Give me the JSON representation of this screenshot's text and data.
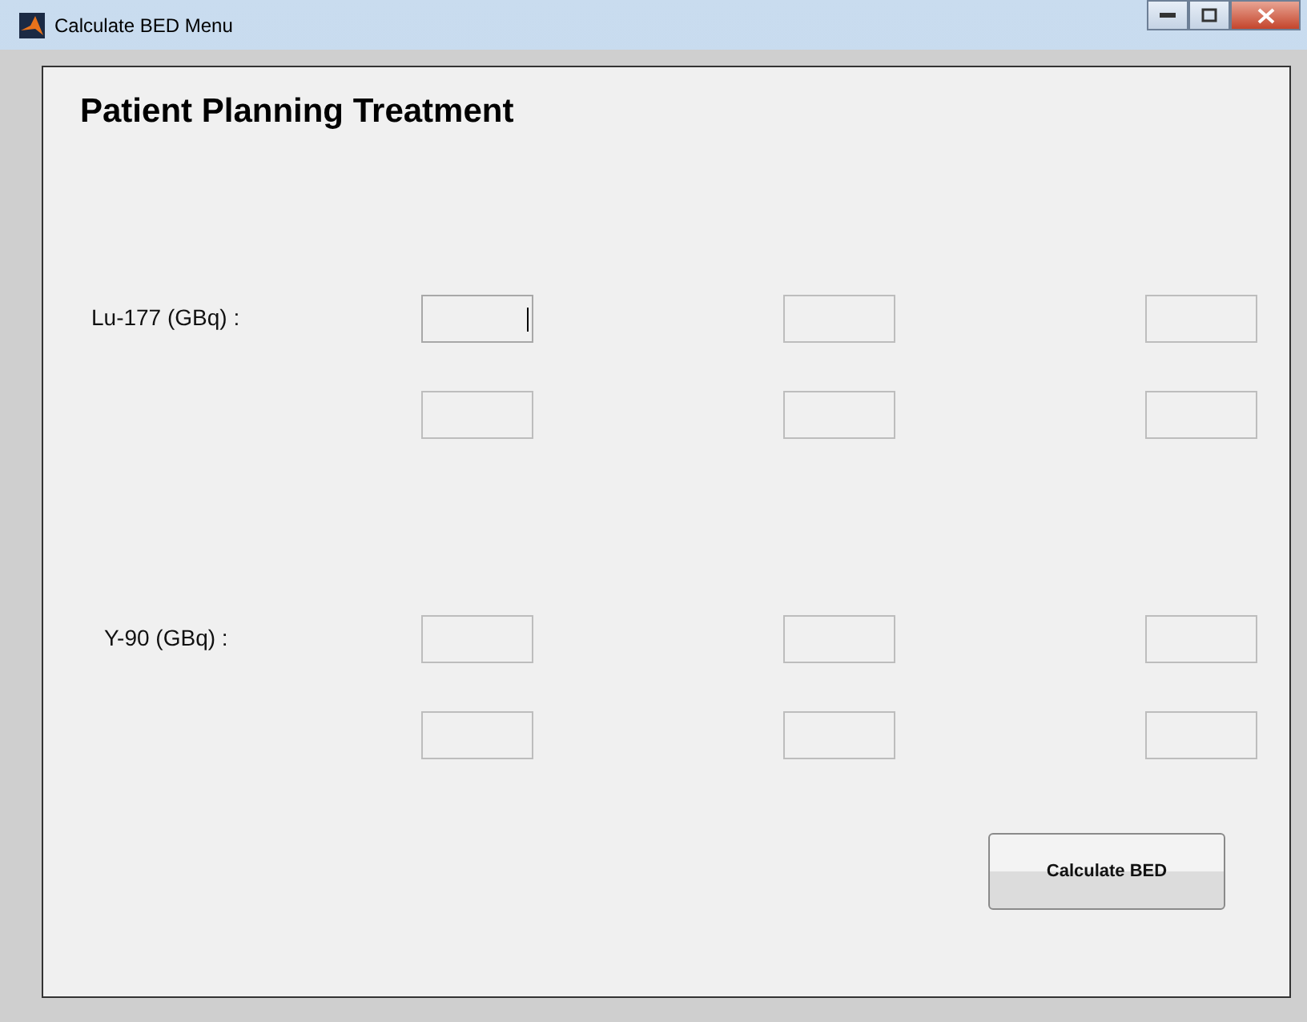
{
  "window": {
    "title": "Calculate BED Menu"
  },
  "heading": "Patient Planning Treatment",
  "groups": [
    {
      "label": "Lu-177 (GBq) :",
      "rows": [
        [
          {
            "focused": true
          },
          {
            "focused": false
          },
          {
            "focused": false
          }
        ],
        [
          {
            "focused": false
          },
          {
            "focused": false
          },
          {
            "focused": false
          }
        ]
      ]
    },
    {
      "label": "Y-90 (GBq) :",
      "rows": [
        [
          {
            "focused": false
          },
          {
            "focused": false
          },
          {
            "focused": false
          }
        ],
        [
          {
            "focused": false
          },
          {
            "focused": false
          },
          {
            "focused": false
          }
        ]
      ]
    }
  ],
  "button": "Calculate BED"
}
